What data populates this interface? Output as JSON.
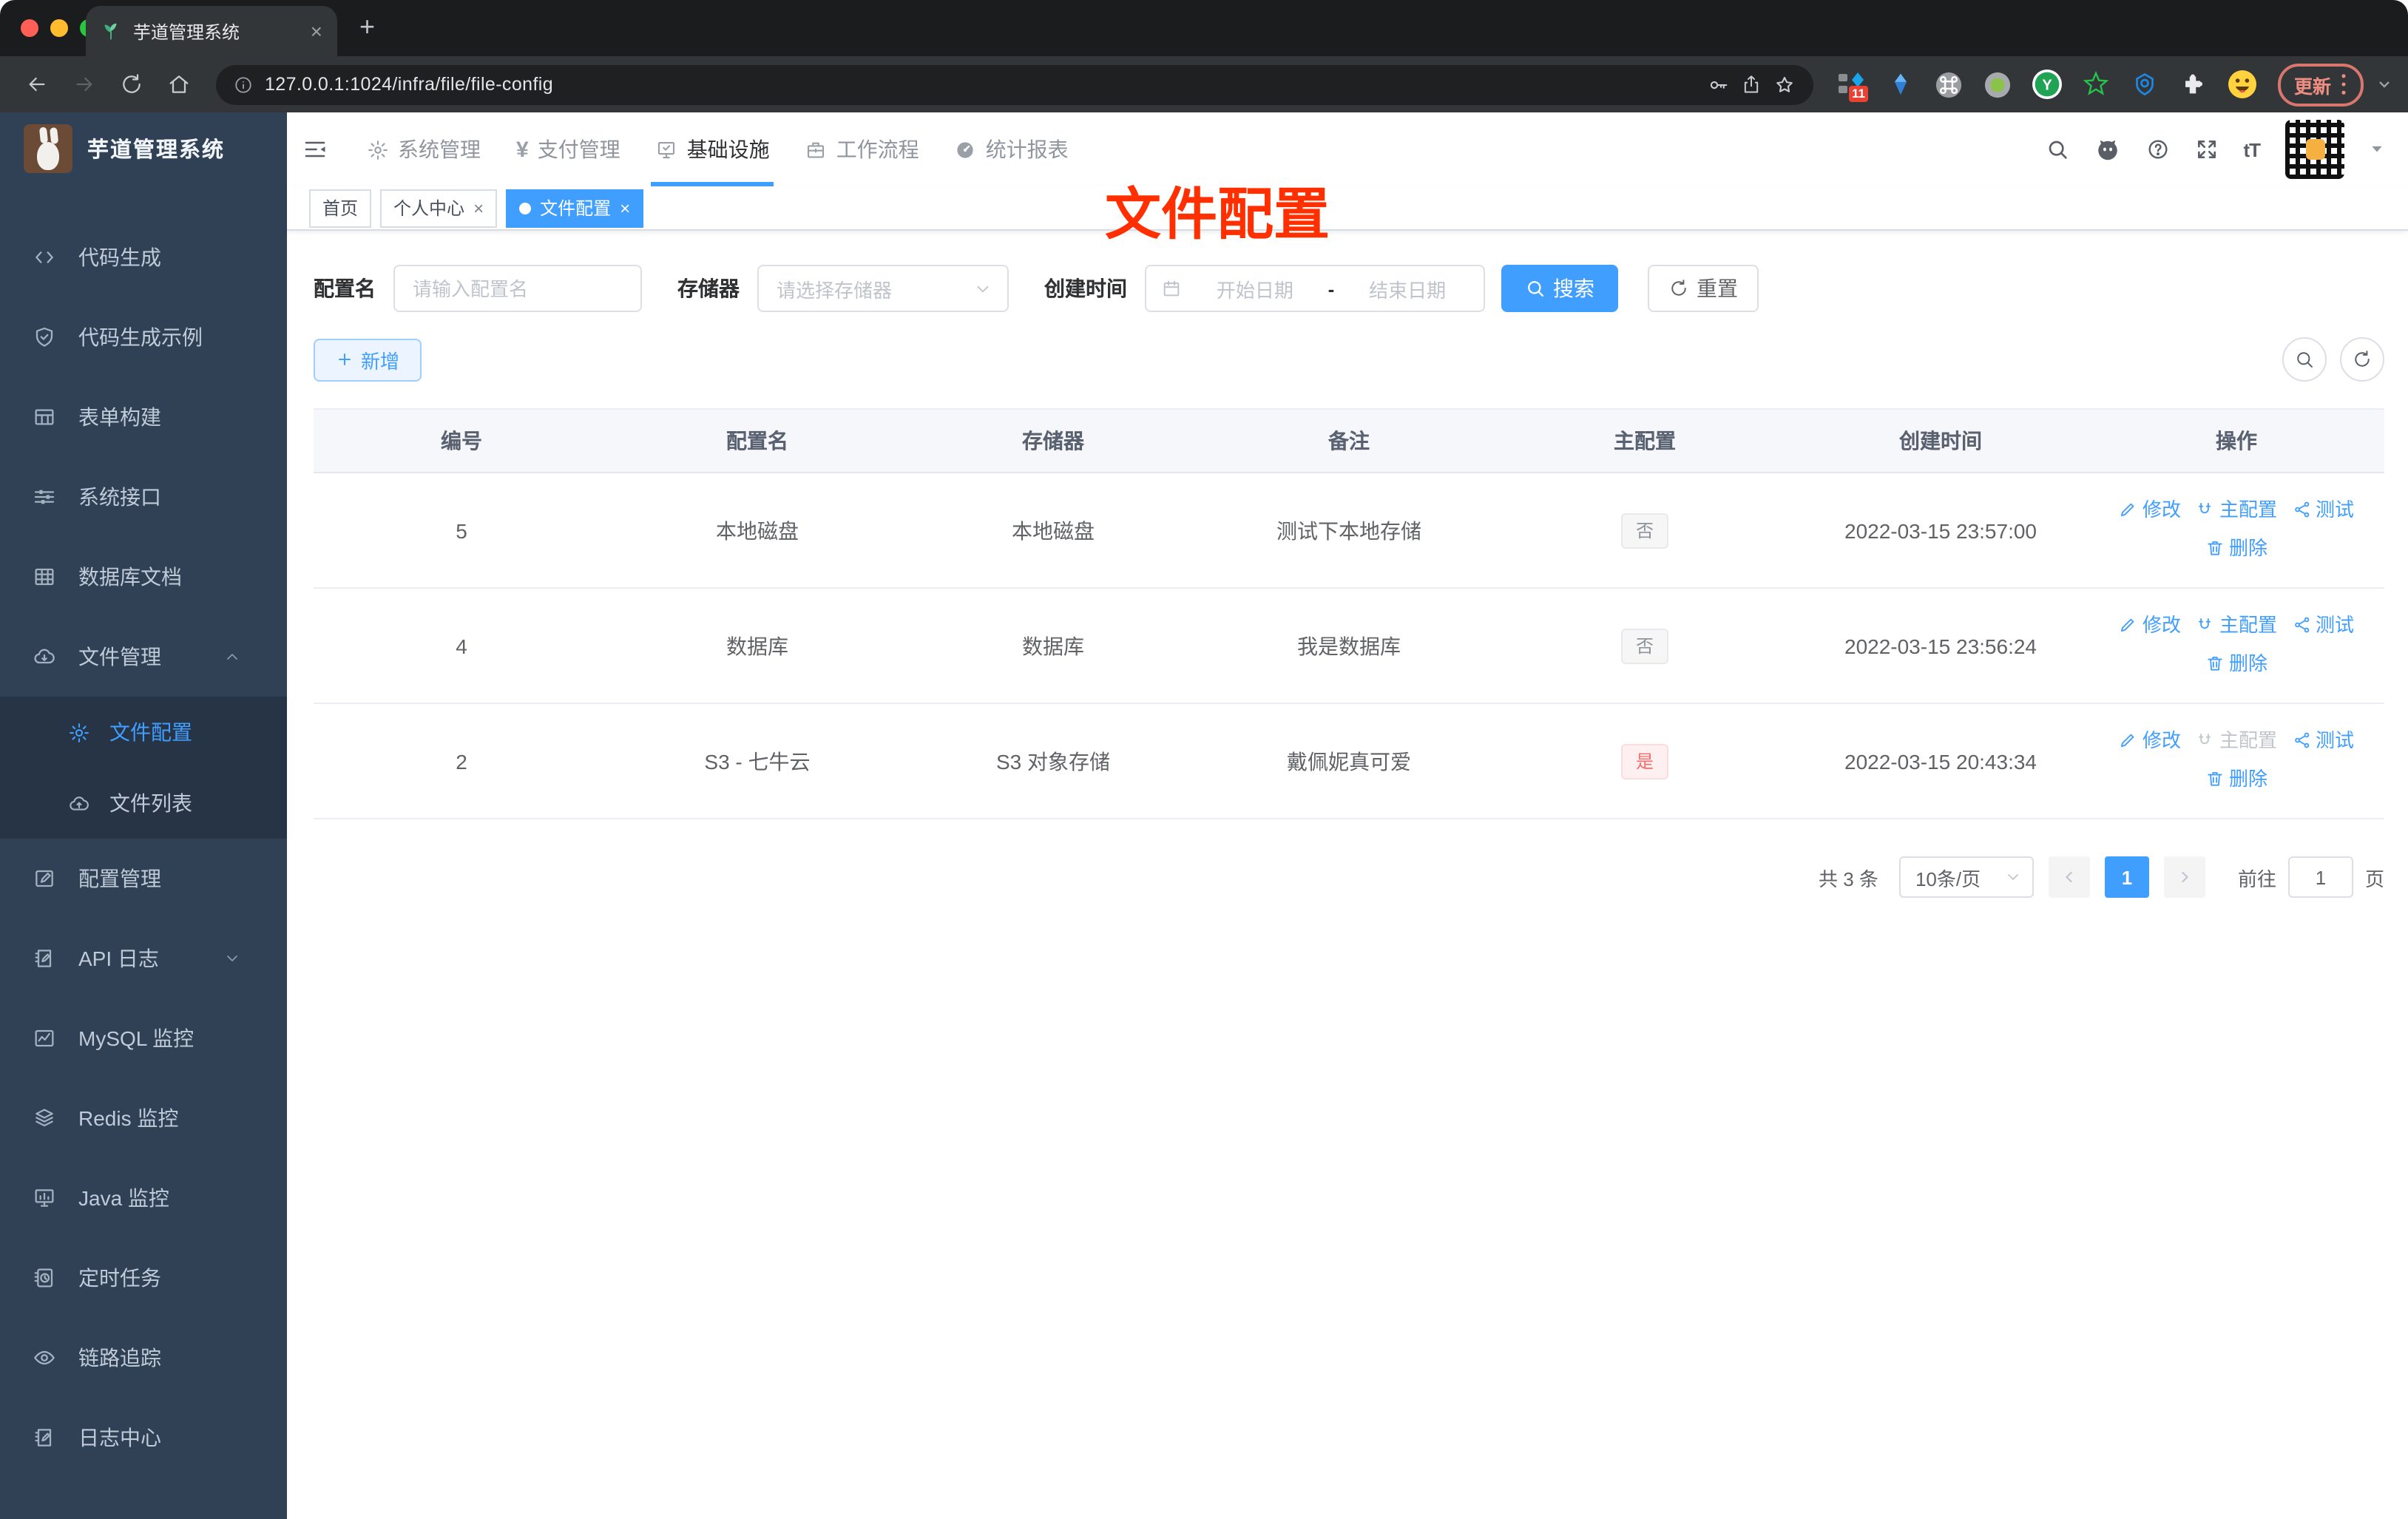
{
  "browser": {
    "tab_title": "芋道管理系统",
    "url": "127.0.0.1:1024/infra/file/file-config",
    "update_label": "更新",
    "extension_badge": "11"
  },
  "glyphs": {
    "close": "×",
    "new_tab": "+",
    "yen": "¥",
    "text_size": "tT"
  },
  "sidebar": {
    "title": "芋道管理系统",
    "items": [
      {
        "label": "代码生成"
      },
      {
        "label": "代码生成示例"
      },
      {
        "label": "表单构建"
      },
      {
        "label": "系统接口"
      },
      {
        "label": "数据库文档"
      },
      {
        "label": "文件管理"
      },
      {
        "label": "文件配置"
      },
      {
        "label": "文件列表"
      },
      {
        "label": "配置管理"
      },
      {
        "label": "API 日志"
      },
      {
        "label": "MySQL 监控"
      },
      {
        "label": "Redis 监控"
      },
      {
        "label": "Java 监控"
      },
      {
        "label": "定时任务"
      },
      {
        "label": "链路追踪"
      },
      {
        "label": "日志中心"
      }
    ]
  },
  "topnav": {
    "items": [
      {
        "label": "系统管理"
      },
      {
        "label": "支付管理"
      },
      {
        "label": "基础设施"
      },
      {
        "label": "工作流程"
      },
      {
        "label": "统计报表"
      }
    ]
  },
  "tags": [
    {
      "label": "首页"
    },
    {
      "label": "个人中心"
    },
    {
      "label": "文件配置"
    }
  ],
  "annotation": "文件配置",
  "filters": {
    "name_label": "配置名",
    "name_placeholder": "请输入配置名",
    "storage_label": "存储器",
    "storage_placeholder": "请选择存储器",
    "date_label": "创建时间",
    "date_start_placeholder": "开始日期",
    "date_separator": "-",
    "date_end_placeholder": "结束日期",
    "search_label": "搜索",
    "reset_label": "重置"
  },
  "toolbar": {
    "add_label": "新增"
  },
  "table": {
    "columns": [
      "编号",
      "配置名",
      "存储器",
      "备注",
      "主配置",
      "创建时间",
      "操作"
    ],
    "actions": {
      "edit": "修改",
      "master": "主配置",
      "test": "测试",
      "delete": "删除"
    },
    "rows": [
      {
        "id": "5",
        "name": "本地磁盘",
        "storage": "本地磁盘",
        "remark": "测试下本地存储",
        "primary": "否",
        "created": "2022-03-15 23:57:00"
      },
      {
        "id": "4",
        "name": "数据库",
        "storage": "数据库",
        "remark": "我是数据库",
        "primary": "否",
        "created": "2022-03-15 23:56:24"
      },
      {
        "id": "2",
        "name": "S3 - 七牛云",
        "storage": "S3 对象存储",
        "remark": "戴佩妮真可爱",
        "primary": "是",
        "created": "2022-03-15 20:43:34"
      }
    ]
  },
  "pagination": {
    "total": "共 3 条",
    "page_size": "10条/页",
    "current_page": "1",
    "goto_label": "前往",
    "goto_value": "1",
    "page_label": "页"
  },
  "colors": {
    "primary": "#409eff",
    "danger": "#f56c6c",
    "annotation_red": "#ff2f00"
  }
}
